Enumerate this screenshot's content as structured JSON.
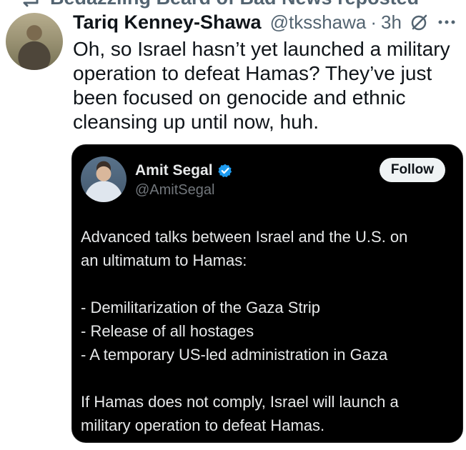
{
  "repost": {
    "text": "Bedazzling Beard of Bad News reposted",
    "icon": "repost-icon"
  },
  "tweet": {
    "display_name": "Tariq Kenney-Shawa",
    "handle": "@tksshawa",
    "separator": "·",
    "time": "3h",
    "avatar_icon": "avatar",
    "grok_icon": "grok-slash-icon",
    "more_icon": "more-icon",
    "text": "Oh, so Israel hasn’t yet launched a military\noperation to defeat Hamas? They’ve just\nbeen focused on genocide and ethnic\ncleansing up until now, huh."
  },
  "quote": {
    "display_name": "Amit Segal",
    "handle": "@AmitSegal",
    "verified_icon": "verified-badge-icon",
    "follow_label": "Follow",
    "lines": [
      "Advanced talks between Israel and the U.S. on",
      "an ultimatum to Hamas:",
      "",
      "- Demilitarization of the Gaza Strip",
      "- Release of all hostages",
      "- A temporary US-led administration in Gaza",
      "",
      "If Hamas does not comply, Israel will launch a",
      "military operation to defeat Hamas."
    ],
    "colors": {
      "card_bg": "#000000",
      "text": "#e7e9ea",
      "handle": "#71767b",
      "verified": "#1d9bf0"
    }
  },
  "colors": {
    "background": "#ffffff",
    "primary_text": "#0f1419",
    "secondary_text": "#536471"
  }
}
